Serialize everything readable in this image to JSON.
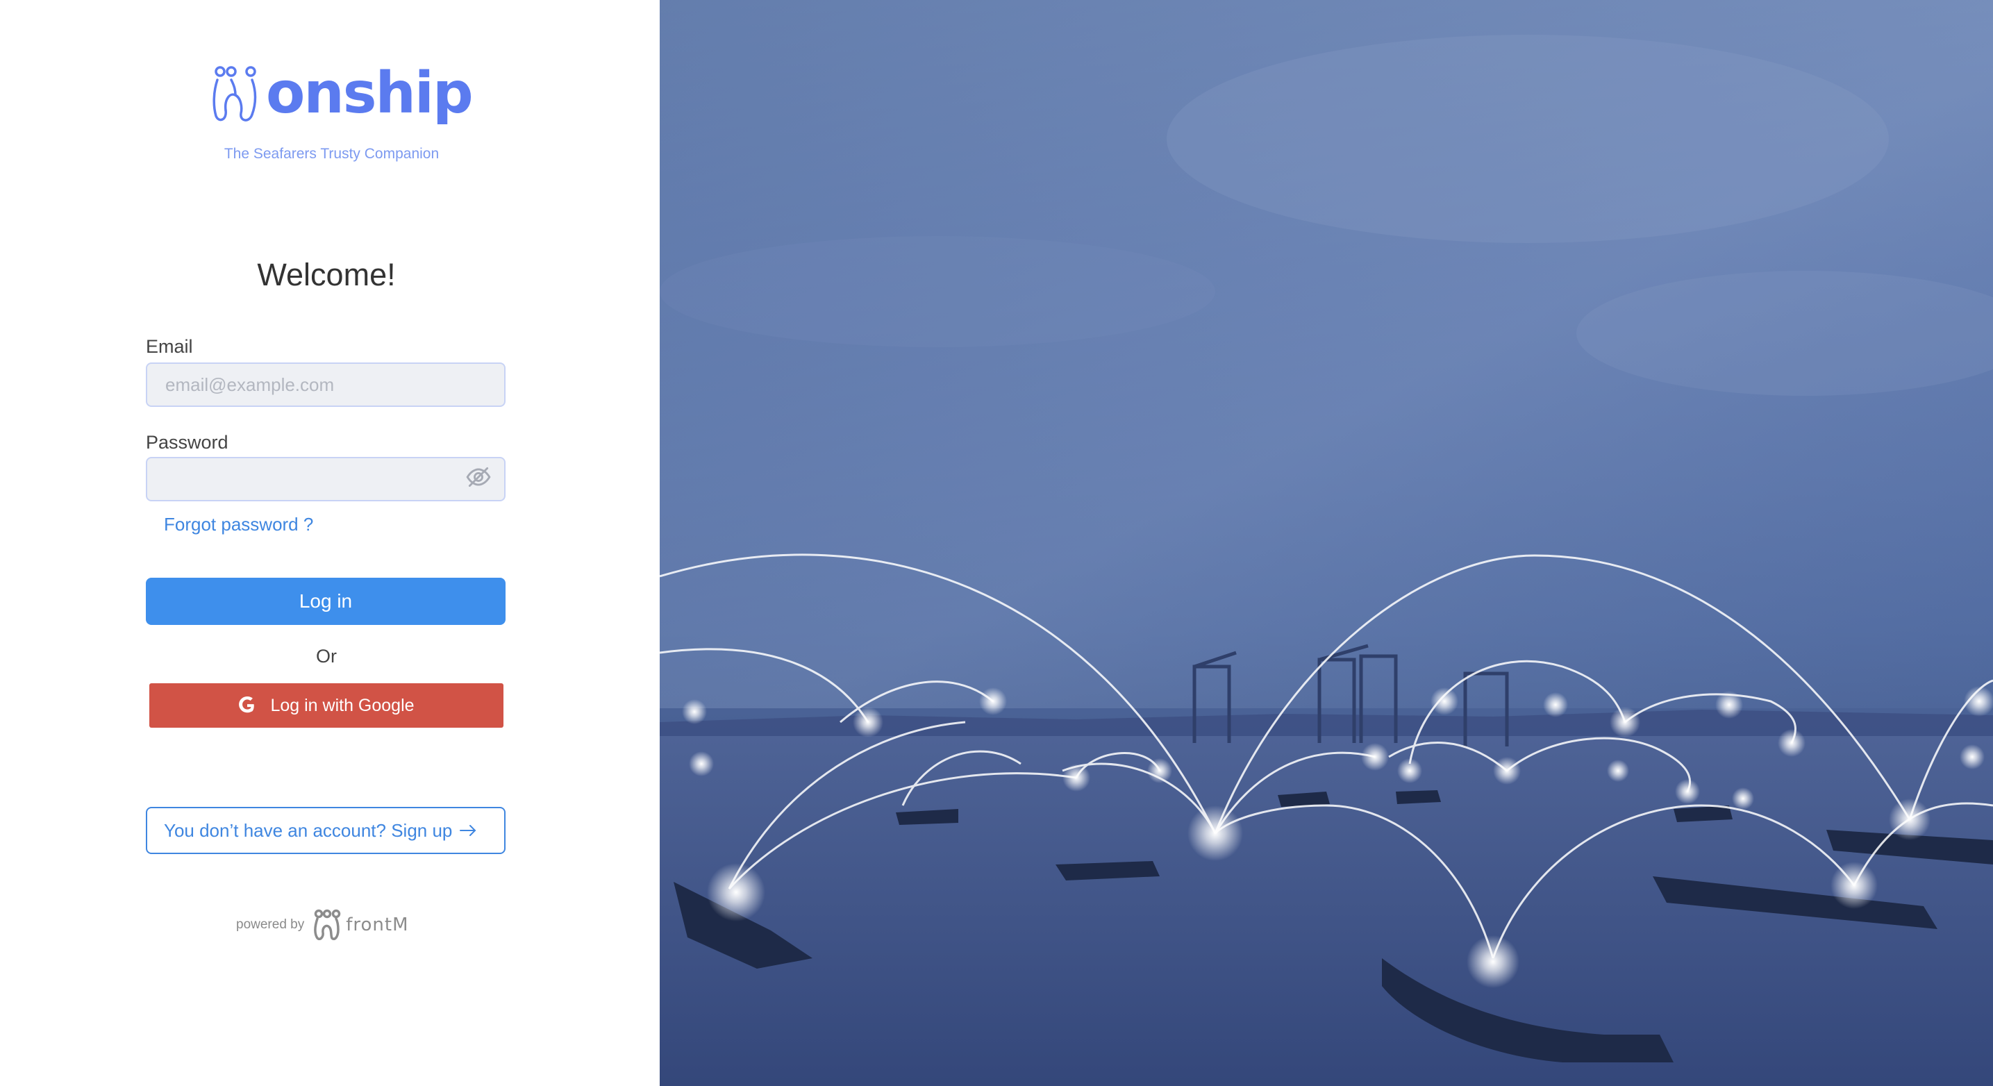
{
  "brand": {
    "name": "onship",
    "tagline": "The Seafarers Trusty Companion"
  },
  "login": {
    "welcome": "Welcome!",
    "email_label": "Email",
    "email_placeholder": "email@example.com",
    "email_value": "",
    "password_label": "Password",
    "password_value": "",
    "forgot_password": "Forgot password ?",
    "login_button": "Log in",
    "or": "Or",
    "google_button": "Log in with Google",
    "signup": "You don’t have an account? Sign up"
  },
  "footer": {
    "powered_by": "powered by",
    "company": "frontM"
  },
  "icons": [
    "onship-logo-icon",
    "eye-off-icon",
    "google-icon",
    "arrow-right-icon",
    "frontm-logo-icon"
  ],
  "colors": {
    "brand": "#5b7bef",
    "primary": "#3e8fec",
    "google": "#d15346",
    "link": "#3f86e0"
  }
}
